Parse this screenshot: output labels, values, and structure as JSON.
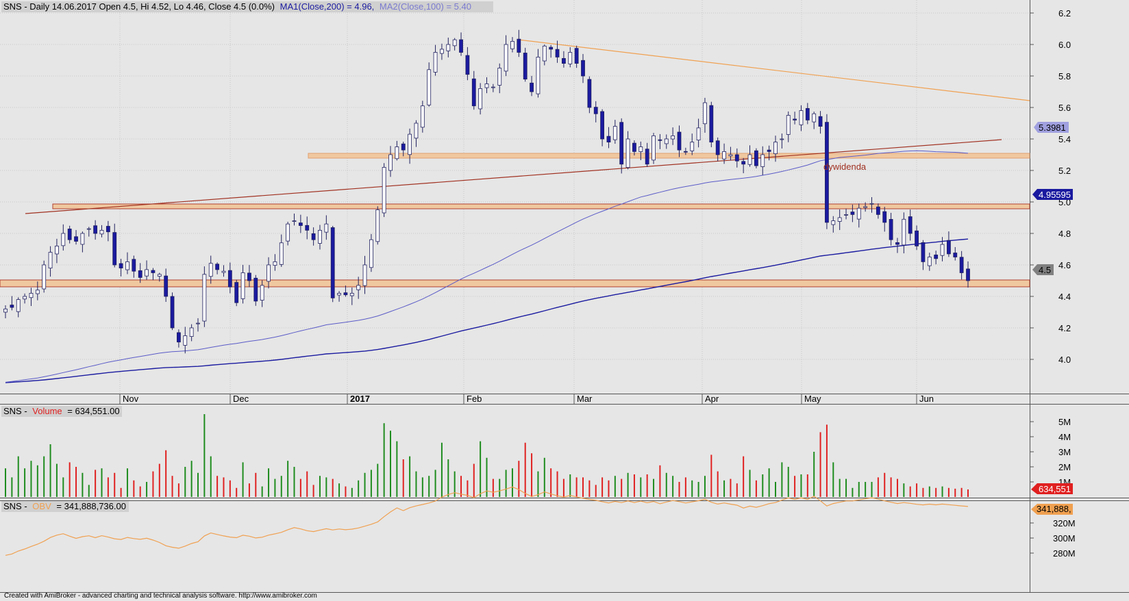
{
  "header": {
    "price_prefix": "SNS - Daily 14.06.2017 Open 4.5, Hi 4.52, Lo 4.46, Close 4.5 (0.0%)",
    "ma1_label": "MA1(Close,200) = 4.96,",
    "ma2_label": "MA2(Close,100) = 5.40",
    "volume_prefix": "SNS -",
    "volume_label": "Volume",
    "volume_value": "= 634,551.00",
    "obv_prefix": "SNS -",
    "obv_label": "OBV",
    "obv_value": "= 341,888,736.00"
  },
  "footer": "Created with AmiBroker - advanced charting and technical analysis software. http://www.amibroker.com",
  "annotation": "dywidenda",
  "colors": {
    "up_candle": "#ffffff",
    "down_candle": "#1a1aa0",
    "ma200": "#1a1aa0",
    "ma100": "#5a5ac8",
    "trendline_orange": "#f0a050",
    "trendline_red": "#a03020",
    "band_orange": "#f0c8a0",
    "band_red": "#b04030",
    "volume_up": "#1e8c1e",
    "volume_down": "#e02020",
    "obv": "#f0a050",
    "background": "#e6e6e6"
  },
  "chart_data": [
    {
      "type": "candlestick",
      "title": "SNS - Daily 14.06.2017",
      "ylim": [
        3.85,
        6.25
      ],
      "y_ticks": [
        "6.2",
        "6.0",
        "5.8",
        "5.6",
        "5.4",
        "5.2",
        "5.0",
        "4.8",
        "4.6",
        "4.4",
        "4.2",
        "4.0"
      ],
      "x_month_labels": [
        {
          "label": "Nov",
          "date": "2016-11-01"
        },
        {
          "label": "Dec",
          "date": "2016-12-01"
        },
        {
          "label": "2017",
          "date": "2017-01-02"
        },
        {
          "label": "Feb",
          "date": "2017-02-01"
        },
        {
          "label": "Mar",
          "date": "2017-03-01"
        },
        {
          "label": "Apr",
          "date": "2017-04-03"
        },
        {
          "label": "May",
          "date": "2017-05-02"
        },
        {
          "label": "Jun",
          "date": "2017-06-01"
        }
      ],
      "closes": [
        4.32,
        4.33,
        4.38,
        4.4,
        4.42,
        4.44,
        4.6,
        4.68,
        4.72,
        4.8,
        4.76,
        4.75,
        4.8,
        4.83,
        4.8,
        4.82,
        4.81,
        4.6,
        4.58,
        4.62,
        4.56,
        4.52,
        4.57,
        4.55,
        4.54,
        4.4,
        4.2,
        4.11,
        4.15,
        4.2,
        4.23,
        4.54,
        4.61,
        4.57,
        4.56,
        4.46,
        4.36,
        4.55,
        4.5,
        4.37,
        4.47,
        4.6,
        4.62,
        4.74,
        4.86,
        4.88,
        4.85,
        4.82,
        4.76,
        4.82,
        4.86,
        4.39,
        4.42,
        4.41,
        4.42,
        4.47,
        4.6,
        4.76,
        4.95,
        5.22,
        5.3,
        5.35,
        5.33,
        5.43,
        5.5,
        5.61,
        5.84,
        5.95,
        5.97,
        6.0,
        6.03,
        5.95,
        5.81,
        5.61,
        5.72,
        5.75,
        5.73,
        5.85,
        6.0,
        6.02,
        5.95,
        5.78,
        5.7,
        5.92,
        5.99,
        5.97,
        5.92,
        5.88,
        5.95,
        5.88,
        5.8,
        5.6,
        5.56,
        5.4,
        5.38,
        5.48,
        5.24,
        5.4,
        5.32,
        5.35,
        5.24,
        5.42,
        5.39,
        5.4,
        5.42,
        5.33,
        5.32,
        5.38,
        5.47,
        5.63,
        5.38,
        5.3,
        5.32,
        5.3,
        5.26,
        5.24,
        5.3,
        5.23,
        5.3,
        5.32,
        5.38,
        5.4,
        5.55,
        5.52,
        5.58,
        5.52,
        5.56,
        5.48,
        4.87,
        4.88,
        4.9,
        4.92,
        4.92,
        4.96,
        4.97,
        4.99,
        4.92,
        4.87,
        4.76,
        4.73,
        4.89,
        4.8,
        4.72,
        4.62,
        4.65,
        4.64,
        4.73,
        4.67,
        4.65,
        4.55,
        4.5
      ]
    },
    {
      "type": "bar",
      "title": "Volume",
      "ylim": [
        0,
        6000000
      ],
      "y_ticks": [
        "5M",
        "4M",
        "3M",
        "2M",
        "1M"
      ],
      "last_value": "634,551",
      "values": [
        1.9,
        1.3,
        2.7,
        1.9,
        2.4,
        2.1,
        2.7,
        3.5,
        2.2,
        1.3,
        2.3,
        2.0,
        1.6,
        0.8,
        1.8,
        1.9,
        1.3,
        1.6,
        0.6,
        1.9,
        1.1,
        0.7,
        1.0,
        1.7,
        2.2,
        3.1,
        1.4,
        0.9,
        2.0,
        2.4,
        1.6,
        5.5,
        2.7,
        1.4,
        1.3,
        1.1,
        0.6,
        2.3,
        0.9,
        1.6,
        0.7,
        1.9,
        1.2,
        1.4,
        2.4,
        2.0,
        1.2,
        1.7,
        0.8,
        1.4,
        1.3,
        1.2,
        0.9,
        0.7,
        0.6,
        1.1,
        1.6,
        1.8,
        2.2,
        4.9,
        4.4,
        3.7,
        2.5,
        2.7,
        1.7,
        1.3,
        1.4,
        1.8,
        3.6,
        2.5,
        1.7,
        1.4,
        1.1,
        2.2,
        3.7,
        2.6,
        1.2,
        1.2,
        1.8,
        1.9,
        2.4,
        3.6,
        2.9,
        1.7,
        2.6,
        1.9,
        1.7,
        1.2,
        1.5,
        1.3,
        1.3,
        1.1,
        0.8,
        1.3,
        1.1,
        1.4,
        1.2,
        1.6,
        1.5,
        1.3,
        1.5,
        1.2,
        2.1,
        1.6,
        1.4,
        1.0,
        1.3,
        1.1,
        1.0,
        1.4,
        2.8,
        1.7,
        1.1,
        1.2,
        0.9,
        2.7,
        1.8,
        1.1,
        1.5,
        1.9,
        1.0,
        2.3,
        2.0,
        1.4,
        1.5,
        1.5,
        3.0,
        4.3,
        4.8,
        2.3,
        1.2,
        1.2,
        0.6,
        1.0,
        1.0,
        1.0,
        1.3,
        1.6,
        1.3,
        1.2,
        0.9,
        0.7,
        0.9,
        0.6,
        0.7,
        0.6,
        0.7,
        0.6,
        0.55,
        0.6,
        0.5
      ]
    },
    {
      "type": "line",
      "title": "OBV",
      "ylim": [
        270000000,
        350000000
      ],
      "y_ticks": [
        "320M",
        "300M",
        "280M"
      ],
      "last_value": "341,888,"
    }
  ],
  "price_axis_badges": {
    "ma100": "5.3981",
    "ma200": "4.95595",
    "close": "4.5"
  }
}
